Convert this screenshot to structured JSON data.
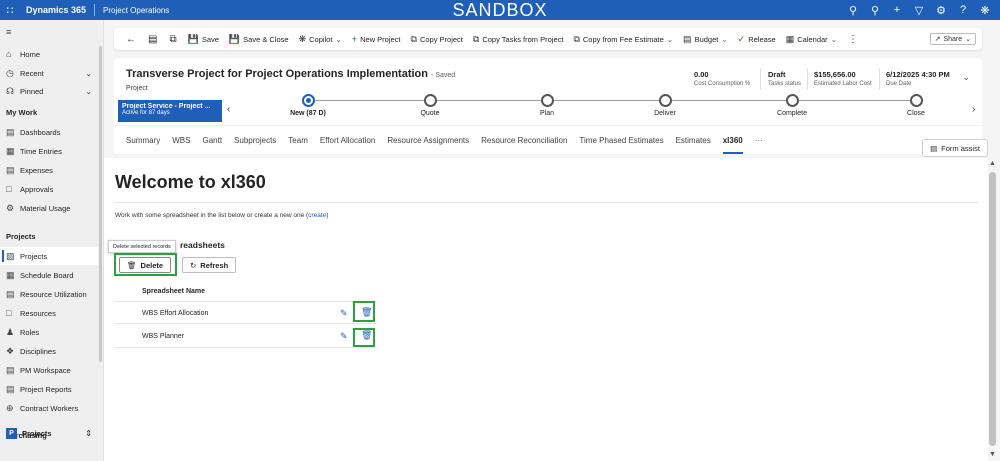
{
  "topbar": {
    "app_name": "Dynamics 365",
    "area_name": "Project Operations",
    "environment": "SANDBOX",
    "icons": [
      "search-icon",
      "lightbulb-icon",
      "plus-icon",
      "filter-icon",
      "gear-icon",
      "help-icon",
      "copilot-icon"
    ]
  },
  "nav": {
    "home": "Home",
    "recent": "Recent",
    "pinned": "Pinned",
    "my_work_header": "My Work",
    "my_work": [
      "Dashboards",
      "Time Entries",
      "Expenses",
      "Approvals",
      "Material Usage"
    ],
    "projects_header": "Projects",
    "projects": [
      "Projects",
      "Schedule Board",
      "Resource Utilization",
      "Resources",
      "Roles",
      "Disciplines",
      "PM Workspace",
      "Project Reports",
      "Contract Workers"
    ],
    "purchasing_header": "Purchasing",
    "area_badge": "P",
    "area_switcher": "Projects"
  },
  "commandbar": {
    "save": "Save",
    "save_close": "Save & Close",
    "copilot": "Copilot",
    "new_project": "New Project",
    "copy_project": "Copy Project",
    "copy_tasks": "Copy Tasks from Project",
    "copy_fee": "Copy from Fee Estimate",
    "budget": "Budget",
    "release": "Release",
    "calendar": "Calendar",
    "share": "Share"
  },
  "record": {
    "title": "Transverse Project for Project Operations Implementation",
    "saved_status": "- Saved",
    "entity": "Project",
    "fields": [
      {
        "value": "0.00",
        "label": "Cost Consumption %"
      },
      {
        "value": "Draft",
        "label": "Tasks status"
      },
      {
        "value": "$155,656.00",
        "label": "Estimated Labor Cost"
      },
      {
        "value": "6/12/2025 4:30 PM",
        "label": "Due Date"
      }
    ]
  },
  "bpf": {
    "active_name": "Project Service - Project ...",
    "active_for": "Active for 87 days",
    "stages": [
      "New  (87 D)",
      "Quote",
      "Plan",
      "Deliver",
      "Complete",
      "Close"
    ]
  },
  "tabs": [
    "Summary",
    "WBS",
    "Gantt",
    "Subprojects",
    "Team",
    "Effort Allocation",
    "Resource Assignments",
    "Resource Reconciliation",
    "Time Phased Estimates",
    "Estimates",
    "xl360",
    "···"
  ],
  "form_assist": "Form assist",
  "content": {
    "welcome": "Welcome to xl360",
    "intro_text": "Work with some spreadsheet in the list below or create a new one (",
    "intro_link": "create",
    "intro_end": ")",
    "section_title": "readsheets",
    "tooltip": "Delete selected records",
    "delete_button": "Delete",
    "refresh_button": "Refresh",
    "column_header": "Spreadsheet Name",
    "rows": [
      "WBS Effort Allocation",
      "WBS Planner"
    ]
  }
}
